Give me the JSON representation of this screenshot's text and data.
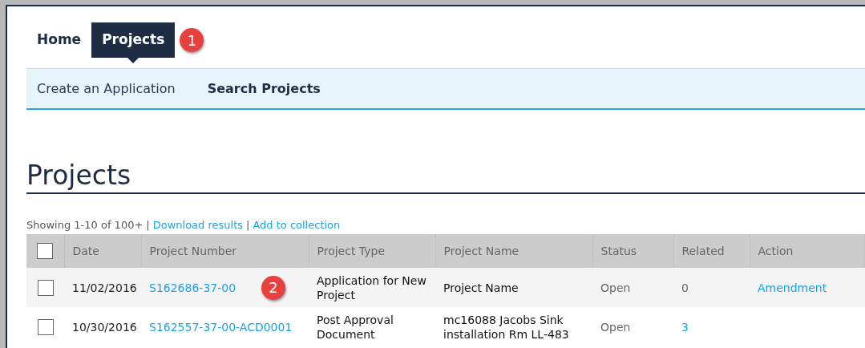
{
  "nav": {
    "tabs": [
      {
        "label": "Home",
        "selected": false
      },
      {
        "label": "Projects",
        "selected": true
      }
    ]
  },
  "subnav": {
    "items": [
      {
        "label": "Create an Application",
        "selected": false
      },
      {
        "label": "Search Projects",
        "selected": true
      }
    ]
  },
  "heading": "Projects",
  "results": {
    "summary": "Showing 1-10 of 100+",
    "links": [
      {
        "separator": "|",
        "label": "Download results"
      },
      {
        "separator": "|",
        "label": "Add to collection"
      }
    ]
  },
  "table": {
    "select_all_checked": false,
    "columns": [
      "Date",
      "Project Number",
      "Project Type",
      "Project Name",
      "Status",
      "Related",
      "Action"
    ],
    "rows": [
      {
        "checked": false,
        "date": "11/02/2016",
        "number": "S162686-37-00",
        "type": "Application for New Project",
        "name": "Project Name",
        "status": "Open",
        "related": {
          "text": "0",
          "link": false
        },
        "action": "Amendment"
      },
      {
        "checked": false,
        "date": "10/30/2016",
        "number": "S162557-37-00-ACD0001",
        "type": "Post Approval Document",
        "name": "mc16088 Jacobs Sink installation Rm LL-483",
        "status": "Open",
        "related": {
          "text": "3",
          "link": true
        }
      }
    ]
  },
  "callouts": [
    "1",
    "2"
  ]
}
